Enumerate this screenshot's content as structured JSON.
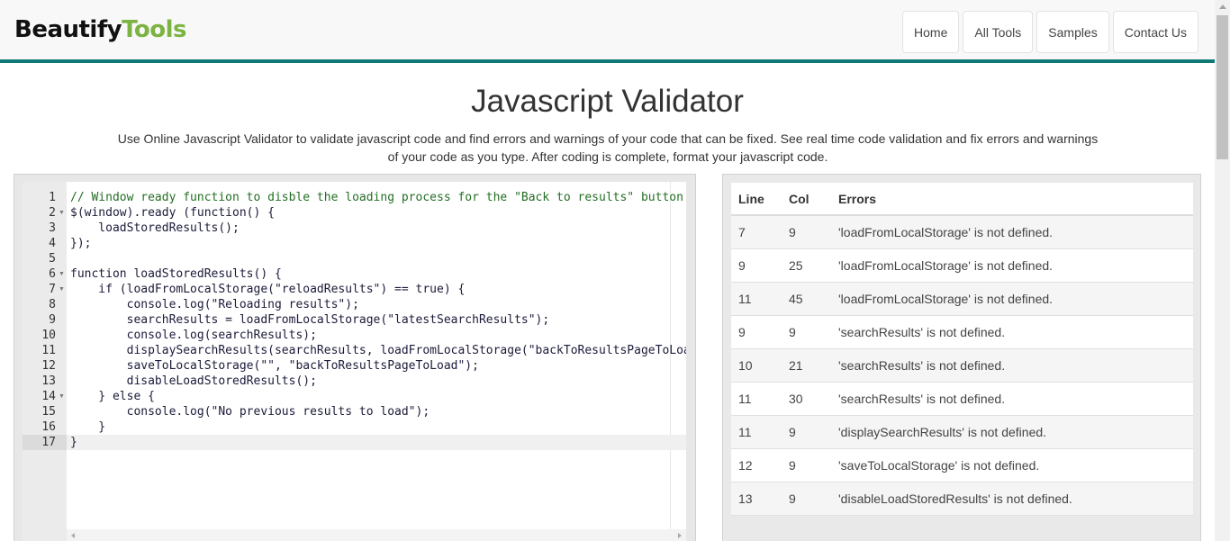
{
  "header": {
    "logo_part1": "Beautify",
    "logo_part2": "Tools",
    "nav": [
      "Home",
      "All Tools",
      "Samples",
      "Contact Us"
    ]
  },
  "page": {
    "title": "Javascript Validator",
    "description_line1": "Use Online Javascript Validator to validate javascript code and find errors and warnings of your code that can be fixed. See real time code validation and fix errors and warnings",
    "description_line2": "of your code as you type. After coding is complete, format your javascript code."
  },
  "editor": {
    "line_numbers": [
      "1",
      "2",
      "3",
      "4",
      "5",
      "6",
      "7",
      "8",
      "9",
      "10",
      "11",
      "12",
      "13",
      "14",
      "15",
      "16",
      "17"
    ],
    "active_line": 17,
    "lines": [
      "// Window ready function to disble the loading process for the \"Back to results\" button.",
      "$(window).ready (function() {",
      "    loadStoredResults();",
      "});",
      "",
      "function loadStoredResults() {",
      "    if (loadFromLocalStorage(\"reloadResults\") == true) {",
      "        console.log(\"Reloading results\");",
      "        searchResults = loadFromLocalStorage(\"latestSearchResults\");",
      "        console.log(searchResults);",
      "        displaySearchResults(searchResults, loadFromLocalStorage(\"backToResultsPageToLoad",
      "        saveToLocalStorage(\"\", \"backToResultsPageToLoad\");",
      "        disableLoadStoredResults();",
      "    } else {",
      "        console.log(\"No previous results to load\");",
      "    }",
      "}"
    ]
  },
  "errors": {
    "headers": [
      "Line",
      "Col",
      "Errors"
    ],
    "rows": [
      [
        "7",
        "9",
        "'loadFromLocalStorage' is not defined."
      ],
      [
        "9",
        "25",
        "'loadFromLocalStorage' is not defined."
      ],
      [
        "11",
        "45",
        "'loadFromLocalStorage' is not defined."
      ],
      [
        "9",
        "9",
        "'searchResults' is not defined."
      ],
      [
        "10",
        "21",
        "'searchResults' is not defined."
      ],
      [
        "11",
        "30",
        "'searchResults' is not defined."
      ],
      [
        "11",
        "9",
        "'displaySearchResults' is not defined."
      ],
      [
        "12",
        "9",
        "'saveToLocalStorage' is not defined."
      ],
      [
        "13",
        "9",
        "'disableLoadStoredResults' is not defined."
      ]
    ]
  },
  "colors": {
    "accent": "#0e7a77",
    "logo_green": "#7cb342"
  }
}
